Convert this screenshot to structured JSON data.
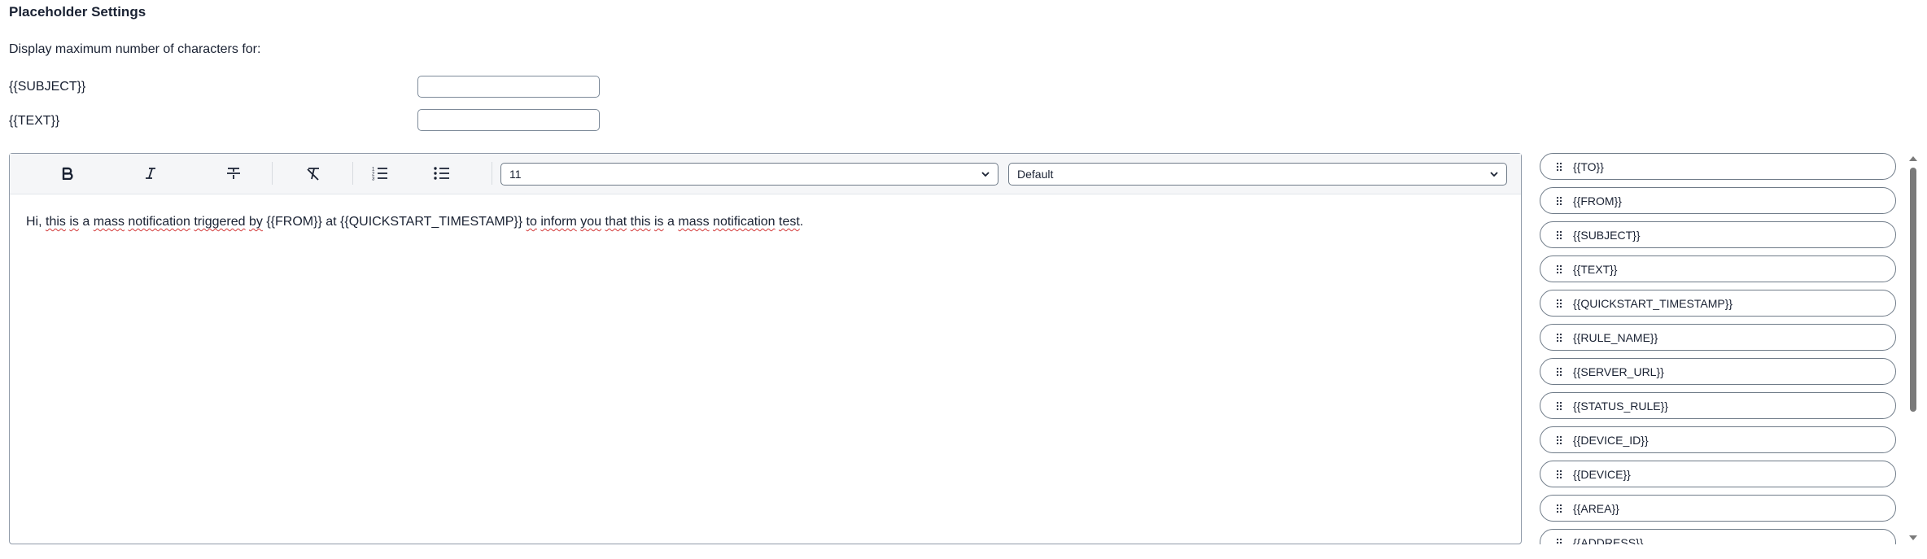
{
  "header": {
    "title": "Placeholder Settings",
    "subtitle": "Display maximum number of characters for:"
  },
  "limits": [
    {
      "label": "{{SUBJECT}}",
      "value": ""
    },
    {
      "label": "{{TEXT}}",
      "value": ""
    }
  ],
  "toolbar": {
    "icons": [
      "bold-icon",
      "italic-icon",
      "strikethrough-icon",
      "clear-formatting-icon",
      "ordered-list-icon",
      "unordered-list-icon"
    ],
    "font_size": "11",
    "font_family": "Default"
  },
  "editor": {
    "parts": [
      "Hi, ",
      "this",
      " ",
      "is",
      " a ",
      "mass",
      " ",
      "notification",
      " ",
      "triggered",
      " ",
      "by",
      " {{FROM}} at {{QUICKSTART_TIMESTAMP}} ",
      "to",
      " ",
      "inform",
      " ",
      "you",
      " ",
      "that",
      " ",
      "this",
      " ",
      "is",
      " a ",
      "mass",
      " ",
      "notification",
      " ",
      "test",
      "."
    ]
  },
  "placeholders": [
    "{{TO}}",
    "{{FROM}}",
    "{{SUBJECT}}",
    "{{TEXT}}",
    "{{QUICKSTART_TIMESTAMP}}",
    "{{RULE_NAME}}",
    "{{SERVER_URL}}",
    "{{STATUS_RULE}}",
    "{{DEVICE_ID}}",
    "{{DEVICE}}",
    "{{AREA}}",
    "{{ADDRESS}}"
  ],
  "colors": {
    "text": "#1a2233",
    "border": "#6f7b88",
    "spellcheck": "#d23a3a",
    "scroll_thumb": "#7a7a7a"
  }
}
